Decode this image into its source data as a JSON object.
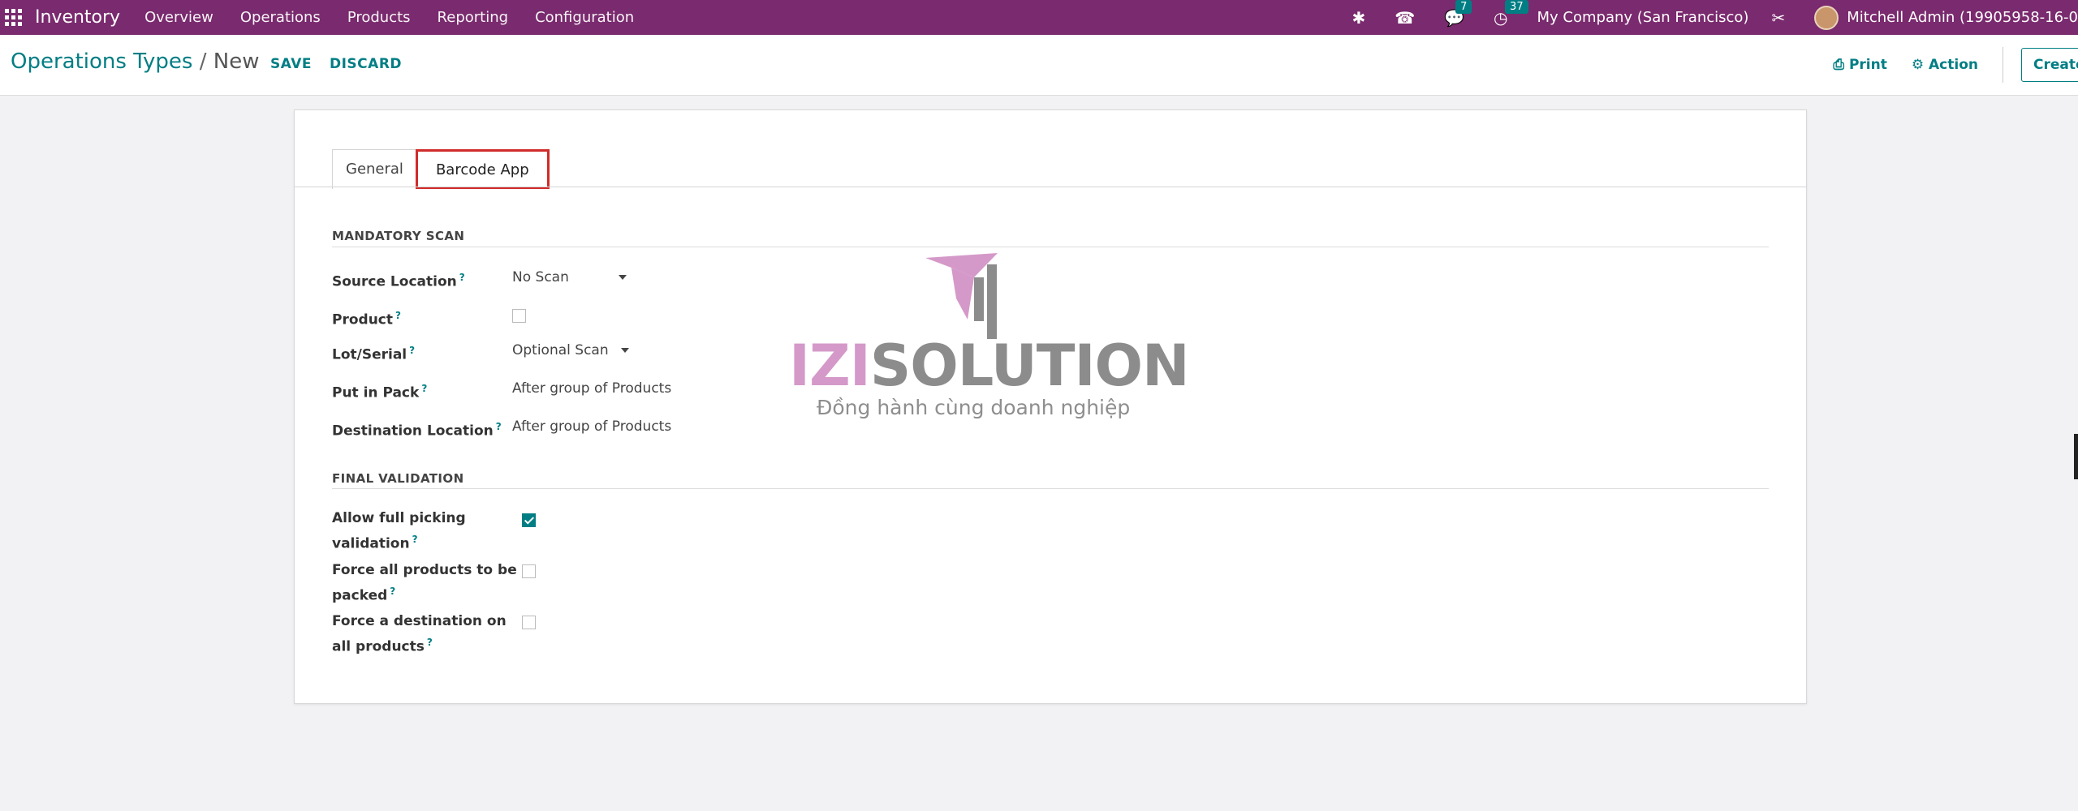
{
  "navbar": {
    "brand": "Inventory",
    "menu": [
      "Overview",
      "Operations",
      "Products",
      "Reporting",
      "Configuration"
    ],
    "messages_count": "7",
    "activities_count": "37",
    "company": "My Company (San Francisco)",
    "user": "Mitchell Admin (19905958-16-0"
  },
  "control_panel": {
    "breadcrumb_parent": "Operations Types",
    "breadcrumb_separator": "/",
    "breadcrumb_current": "New",
    "save_label": "SAVE",
    "discard_label": "DISCARD",
    "print_label": "Print",
    "action_label": "Action",
    "create_label": "Create"
  },
  "tabs": {
    "general": "General",
    "barcode": "Barcode App"
  },
  "mandatory_scan": {
    "title": "MANDATORY SCAN",
    "source_location_label": "Source Location",
    "source_location_value": "No Scan",
    "product_label": "Product",
    "product_checked": false,
    "lot_serial_label": "Lot/Serial",
    "lot_serial_value": "Optional Scan",
    "put_in_pack_label": "Put in Pack",
    "put_in_pack_value": "After group of Products",
    "destination_location_label": "Destination Location",
    "destination_location_value": "After group of Products"
  },
  "final_validation": {
    "title": "FINAL VALIDATION",
    "allow_full_line1": "Allow full picking",
    "allow_full_line2": "validation",
    "allow_full_checked": true,
    "force_pack_line1": "Force all products to be",
    "force_pack_line2": "packed",
    "force_pack_checked": false,
    "force_dest_line1": "Force a destination on",
    "force_dest_line2": "all products",
    "force_dest_checked": false
  },
  "help_mark": "?",
  "watermark": {
    "izi": "IZI",
    "solution": "SOLUTION",
    "tagline": "Đồng hành cùng doanh nghiệp"
  }
}
